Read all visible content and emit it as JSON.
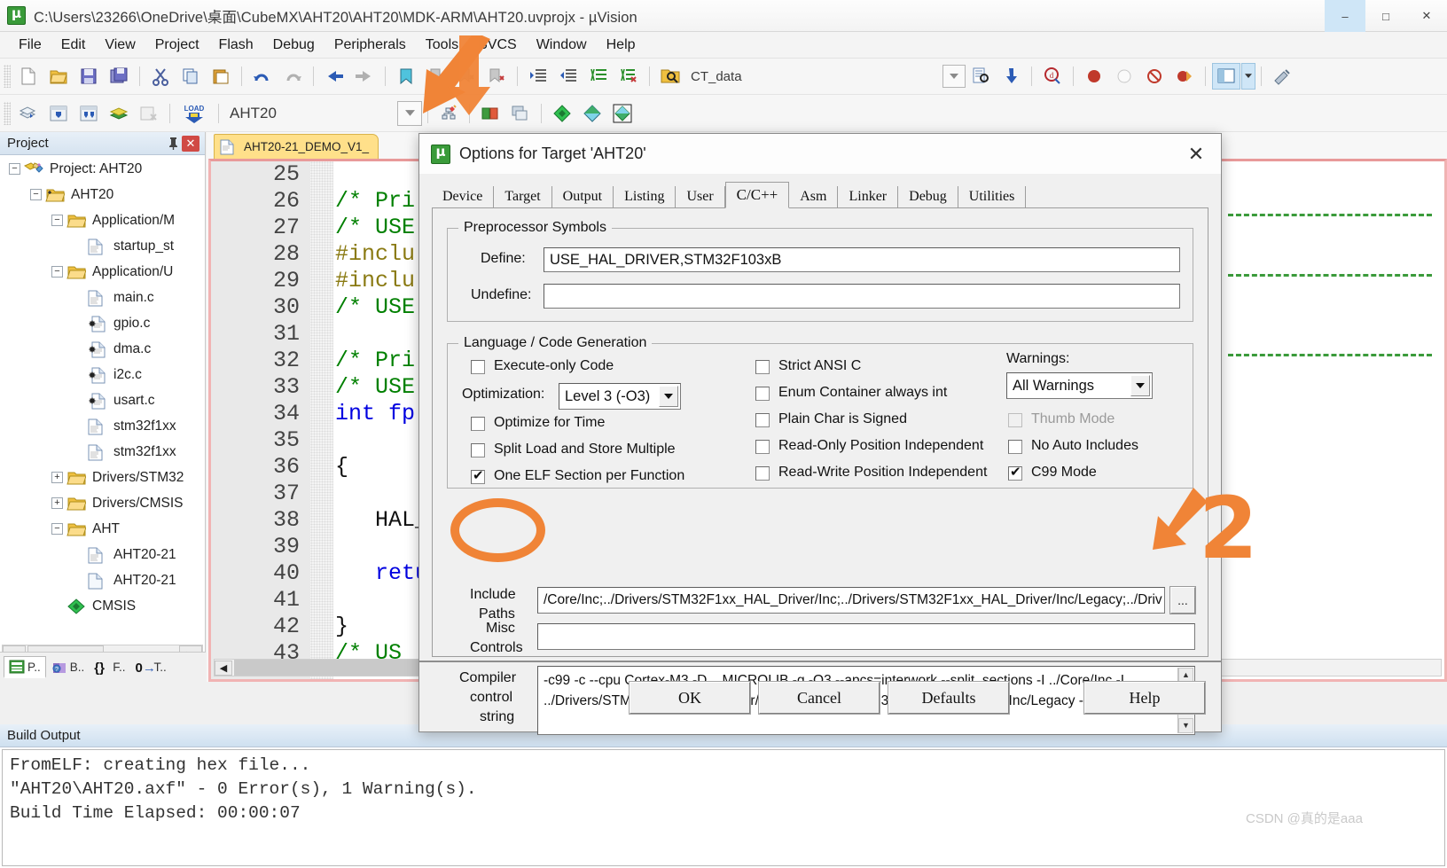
{
  "window": {
    "title": "C:\\Users\\23266\\OneDrive\\桌面\\CubeMX\\AHT20\\AHT20\\MDK-ARM\\AHT20.uvprojx - µVision",
    "icon": "uvision-icon",
    "minimize": "–",
    "maximize": "□",
    "close": "✕"
  },
  "menubar": {
    "items": [
      "File",
      "Edit",
      "View",
      "Project",
      "Flash",
      "Debug",
      "Peripherals",
      "Tools",
      "SVCS",
      "Window",
      "Help"
    ]
  },
  "toolbar2": {
    "target_value": "AHT20",
    "batch_value": "CT_data"
  },
  "project_panel": {
    "title": "Project",
    "pin_icon": "pin-icon",
    "close_icon": "close-icon",
    "tree": [
      {
        "label": "Project: AHT20",
        "depth": 0,
        "expander": "−",
        "icon": "project-icon"
      },
      {
        "label": "AHT20",
        "depth": 1,
        "expander": "−",
        "icon": "target-folder-icon"
      },
      {
        "label": "Application/M",
        "depth": 2,
        "expander": "−",
        "icon": "folder-icon"
      },
      {
        "label": "startup_st",
        "depth": 3,
        "expander": "",
        "icon": "asm-file-icon"
      },
      {
        "label": "Application/U",
        "depth": 2,
        "expander": "−",
        "icon": "folder-icon"
      },
      {
        "label": "main.c",
        "depth": 3,
        "expander": "",
        "icon": "c-file-icon"
      },
      {
        "label": "gpio.c",
        "depth": 3,
        "expander": "",
        "icon": "c-file-build-icon"
      },
      {
        "label": "dma.c",
        "depth": 3,
        "expander": "",
        "icon": "c-file-build-icon"
      },
      {
        "label": "i2c.c",
        "depth": 3,
        "expander": "",
        "icon": "c-file-build-icon"
      },
      {
        "label": "usart.c",
        "depth": 3,
        "expander": "",
        "icon": "c-file-build-icon"
      },
      {
        "label": "stm32f1xx",
        "depth": 3,
        "expander": "",
        "icon": "c-file-icon"
      },
      {
        "label": "stm32f1xx",
        "depth": 3,
        "expander": "",
        "icon": "c-file-icon"
      },
      {
        "label": "Drivers/STM32",
        "depth": 2,
        "expander": "+",
        "icon": "folder-icon"
      },
      {
        "label": "Drivers/CMSIS",
        "depth": 2,
        "expander": "+",
        "icon": "folder-icon"
      },
      {
        "label": "AHT",
        "depth": 2,
        "expander": "−",
        "icon": "folder-icon"
      },
      {
        "label": "AHT20-21",
        "depth": 3,
        "expander": "",
        "icon": "c-file-icon"
      },
      {
        "label": "AHT20-21",
        "depth": 3,
        "expander": "",
        "icon": "h-file-icon"
      },
      {
        "label": "CMSIS",
        "depth": 2,
        "expander": "",
        "icon": "cmsis-icon"
      }
    ],
    "tabs": [
      {
        "label": "P..",
        "icon": "project-tab-icon",
        "selected": true
      },
      {
        "label": "B..",
        "icon": "books-tab-icon",
        "selected": false
      },
      {
        "label": "F..",
        "icon": "functions-tab-icon",
        "selected": false
      },
      {
        "label": "T..",
        "icon": "templates-tab-icon",
        "selected": false
      }
    ]
  },
  "editor": {
    "tab_label": "AHT20-21_DEMO_V1_",
    "tab_icon": "c-file-icon",
    "first_line": 25,
    "lines": [
      {
        "n": 25,
        "text": "",
        "cls": ""
      },
      {
        "n": 26,
        "text": "/* Pri",
        "cls": "c-cm"
      },
      {
        "n": 27,
        "text": "/* USE",
        "cls": "c-cm"
      },
      {
        "n": 28,
        "text": "#inclu",
        "cls": "c-pp"
      },
      {
        "n": 29,
        "text": "#inclu",
        "cls": "c-pp"
      },
      {
        "n": 30,
        "text": "/* USE",
        "cls": "c-cm"
      },
      {
        "n": 31,
        "text": "",
        "cls": ""
      },
      {
        "n": 32,
        "text": "/* Pri",
        "cls": "c-cm"
      },
      {
        "n": 33,
        "text": "/* USE",
        "cls": "c-cm"
      },
      {
        "n": 34,
        "text": "int fp",
        "cls": "c-kw"
      },
      {
        "n": 35,
        "text": "",
        "cls": ""
      },
      {
        "n": 36,
        "text": "{",
        "cls": "c-id"
      },
      {
        "n": 37,
        "text": "",
        "cls": ""
      },
      {
        "n": 38,
        "text": "   HAL_",
        "cls": "c-id"
      },
      {
        "n": 39,
        "text": "",
        "cls": ""
      },
      {
        "n": 40,
        "text": "   retu",
        "cls": "c-kw"
      },
      {
        "n": 41,
        "text": "",
        "cls": ""
      },
      {
        "n": 42,
        "text": "}",
        "cls": "c-id"
      },
      {
        "n": 43,
        "text": "/* US",
        "cls": "c-cm"
      }
    ]
  },
  "build_output": {
    "title": "Build Output",
    "lines": [
      "FromELF: creating hex file...",
      "\"AHT20\\AHT20.axf\" - 0 Error(s), 1 Warning(s).",
      "Build Time Elapsed:  00:00:07"
    ]
  },
  "dialog": {
    "title": "Options for Target 'AHT20'",
    "icon": "uvision-icon",
    "close_icon": "close-icon",
    "tabs": [
      {
        "label": "Device",
        "active": false
      },
      {
        "label": "Target",
        "active": false
      },
      {
        "label": "Output",
        "active": false
      },
      {
        "label": "Listing",
        "active": false
      },
      {
        "label": "User",
        "active": false
      },
      {
        "label": "C/C++",
        "active": true
      },
      {
        "label": "Asm",
        "active": false
      },
      {
        "label": "Linker",
        "active": false
      },
      {
        "label": "Debug",
        "active": false
      },
      {
        "label": "Utilities",
        "active": false
      }
    ],
    "preprocessor": {
      "legend": "Preprocessor Symbols",
      "define_label": "Define:",
      "define_value": "USE_HAL_DRIVER,STM32F103xB",
      "undefine_label": "Undefine:",
      "undefine_value": ""
    },
    "language": {
      "legend": "Language / Code Generation",
      "left_checks": [
        {
          "label": "Execute-only Code",
          "checked": false,
          "disabled": false
        },
        {
          "label": "Optimize for Time",
          "checked": false,
          "disabled": false
        },
        {
          "label": "Split Load and Store Multiple",
          "checked": false,
          "disabled": false
        },
        {
          "label": "One ELF Section per Function",
          "checked": true,
          "disabled": false
        }
      ],
      "optimization_label": "Optimization:",
      "optimization_value": "Level 3 (-O3)",
      "mid_checks": [
        {
          "label": "Strict ANSI C",
          "checked": false,
          "disabled": false
        },
        {
          "label": "Enum Container always int",
          "checked": false,
          "disabled": false
        },
        {
          "label": "Plain Char is Signed",
          "checked": false,
          "disabled": false
        },
        {
          "label": "Read-Only Position Independent",
          "checked": false,
          "disabled": false
        },
        {
          "label": "Read-Write Position Independent",
          "checked": false,
          "disabled": false
        }
      ],
      "warnings_label": "Warnings:",
      "warnings_value": "All Warnings",
      "right_checks": [
        {
          "label": "Thumb Mode",
          "checked": false,
          "disabled": true
        },
        {
          "label": "No Auto Includes",
          "checked": false,
          "disabled": false
        },
        {
          "label": "C99 Mode",
          "checked": true,
          "disabled": false
        }
      ]
    },
    "include_paths": {
      "label_line1": "Include",
      "label_line2": "Paths",
      "value": "/Core/Inc;../Drivers/STM32F1xx_HAL_Driver/Inc;../Drivers/STM32F1xx_HAL_Driver/Inc/Legacy;../Driv",
      "browse_label": "..."
    },
    "misc_controls": {
      "label_line1": "Misc",
      "label_line2": "Controls",
      "value": ""
    },
    "compiler_string": {
      "label_line1": "Compiler",
      "label_line2": "control",
      "label_line3": "string",
      "line1": "-c99 -c --cpu Cortex-M3 -D__MICROLIB -g -O3 --apcs=interwork --split_sections -I ../Core/Inc -I",
      "line2": "../Drivers/STM32F1xx_HAL_Driver/Inc -I ../Drivers/STM32F1xx_HAL_Driver/Inc/Legacy -I"
    },
    "buttons": [
      {
        "label": "OK"
      },
      {
        "label": "Cancel"
      },
      {
        "label": "Defaults"
      },
      {
        "label": "Help"
      }
    ]
  },
  "annotations": {
    "step2_number": "2",
    "accent_color": "#F08437",
    "circle_target": "Include Paths",
    "arrow1_target": "project-options-toolbar-button",
    "arrow2_target": "include-paths-browse-button"
  },
  "watermark": {
    "text": "CSDN @真的是aaa"
  }
}
